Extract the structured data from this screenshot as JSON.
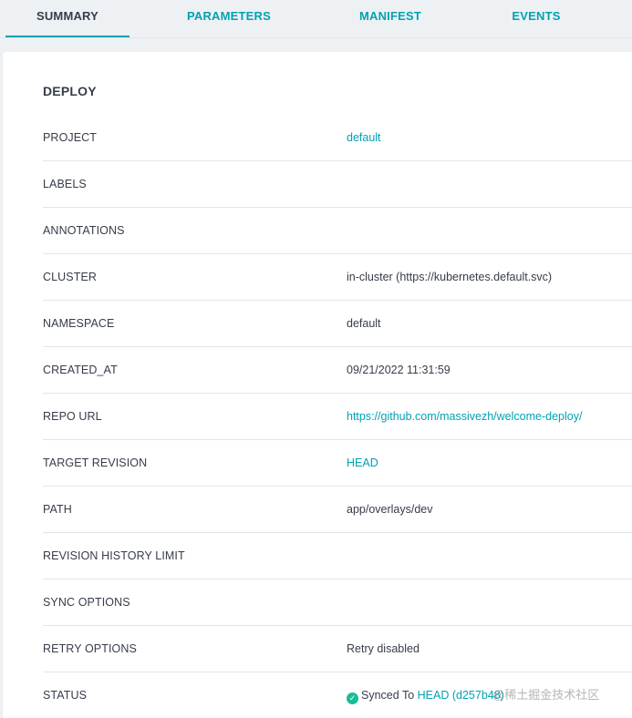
{
  "tabs": [
    {
      "label": "SUMMARY",
      "active": true
    },
    {
      "label": "PARAMETERS",
      "active": false
    },
    {
      "label": "MANIFEST",
      "active": false
    },
    {
      "label": "EVENTS",
      "active": false
    }
  ],
  "section": {
    "title": "DEPLOY"
  },
  "rows": {
    "project": {
      "label": "PROJECT",
      "value": "default"
    },
    "labels": {
      "label": "LABELS",
      "value": ""
    },
    "annotations": {
      "label": "ANNOTATIONS",
      "value": ""
    },
    "cluster": {
      "label": "CLUSTER",
      "value": "in-cluster (https://kubernetes.default.svc)"
    },
    "namespace": {
      "label": "NAMESPACE",
      "value": "default"
    },
    "created_at": {
      "label": "CREATED_AT",
      "value": "09/21/2022 11:31:59"
    },
    "repo_url": {
      "label": "REPO URL",
      "value": "https://github.com/massivezh/welcome-deploy/"
    },
    "target_revision": {
      "label": "TARGET REVISION",
      "value": "HEAD"
    },
    "path": {
      "label": "PATH",
      "value": "app/overlays/dev"
    },
    "revision_history_limit": {
      "label": "REVISION HISTORY LIMIT",
      "value": ""
    },
    "sync_options": {
      "label": "SYNC OPTIONS",
      "value": ""
    },
    "retry_options": {
      "label": "RETRY OPTIONS",
      "value": "Retry disabled"
    },
    "status": {
      "label": "STATUS",
      "text": "Synced To",
      "link": "HEAD (d257b48)",
      "icon": "check-circle-icon",
      "icon_color": "#18be94"
    }
  },
  "watermark": "@稀土掘金技术社区",
  "colors": {
    "accent": "#00a2b3",
    "text": "#363c4a",
    "divider": "#dee6eb"
  }
}
